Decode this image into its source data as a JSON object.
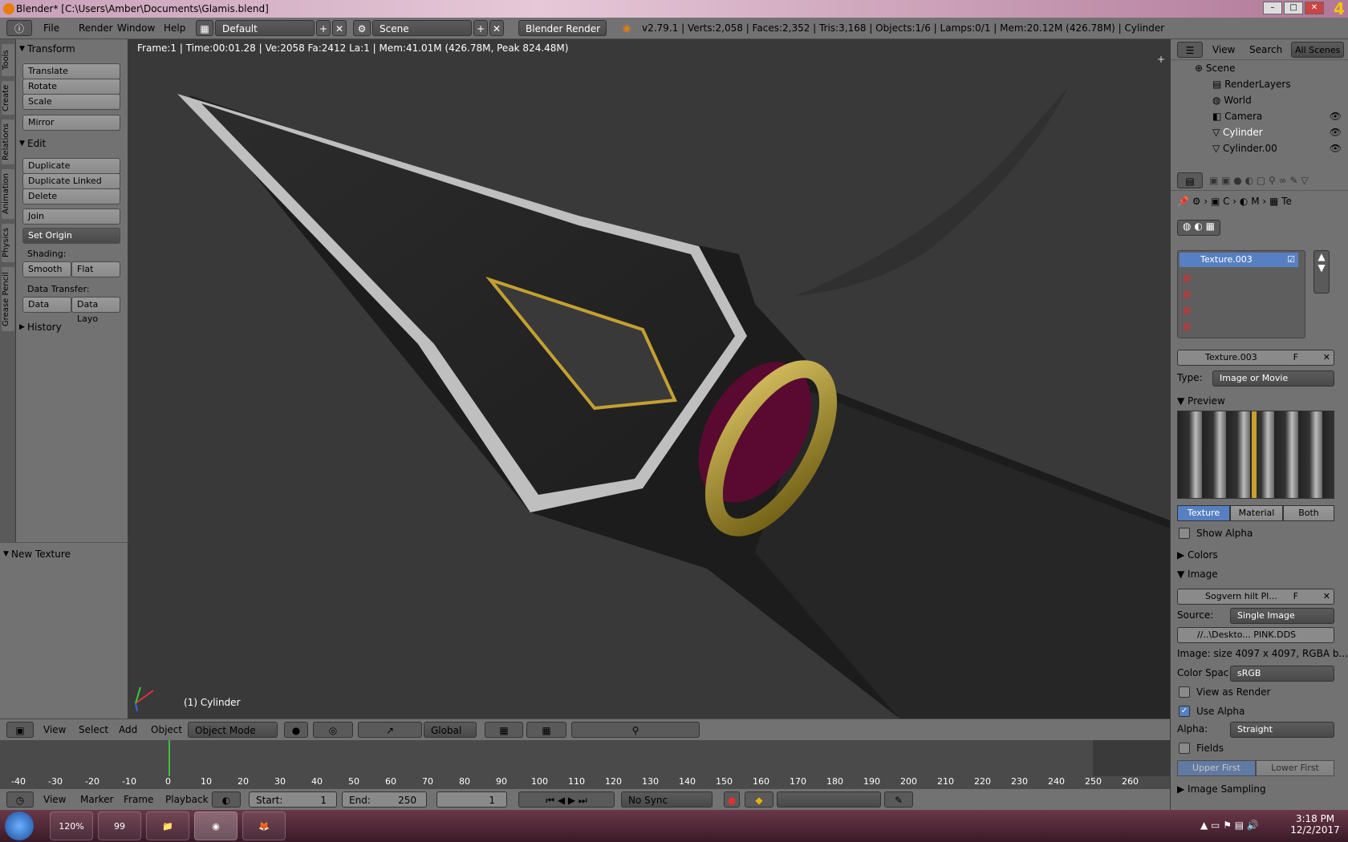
{
  "window": {
    "title": "Blender* [C:\\Users\\Amber\\Documents\\Glamis.blend]",
    "corner_badge": "4"
  },
  "topbar": {
    "menus": [
      "File",
      "Render",
      "Window",
      "Help"
    ],
    "layout": "Default",
    "scene": "Scene",
    "engine": "Blender Render",
    "stats": "v2.79.1 | Verts:2,058 | Faces:2,352 | Tris:3,168 | Objects:1/6 | Lamps:0/1 | Mem:20.12M (426.78M) | Cylinder"
  },
  "left_tabs": [
    "Tools",
    "Create",
    "Relations",
    "Animation",
    "Physics",
    "Grease Pencil"
  ],
  "tools": {
    "transform_title": "Transform",
    "translate": "Translate",
    "rotate": "Rotate",
    "scale": "Scale",
    "mirror": "Mirror",
    "edit_title": "Edit",
    "duplicate": "Duplicate",
    "duplicate_linked": "Duplicate Linked",
    "delete": "Delete",
    "join": "Join",
    "set_origin": "Set Origin",
    "shading_label": "Shading:",
    "smooth": "Smooth",
    "flat": "Flat",
    "data_transfer_label": "Data Transfer:",
    "data": "Data",
    "data_layo": "Data Layo",
    "history_title": "History",
    "new_texture_title": "New Texture"
  },
  "viewport": {
    "info": "Frame:1 | Time:00:01.28 | Ve:2058 Fa:2412 La:1 | Mem:41.01M (426.78M, Peak 824.48M)",
    "object_label": "(1) Cylinder"
  },
  "viewport_header": {
    "view": "View",
    "select": "Select",
    "add": "Add",
    "object": "Object",
    "mode": "Object Mode",
    "orientation": "Global"
  },
  "timeline": {
    "ticks": [
      "-40",
      "-30",
      "-20",
      "-10",
      "0",
      "10",
      "20",
      "30",
      "40",
      "50",
      "60",
      "70",
      "80",
      "90",
      "100",
      "110",
      "120",
      "130",
      "140",
      "150",
      "160",
      "170",
      "180",
      "190",
      "200",
      "210",
      "220",
      "230",
      "240",
      "250",
      "260"
    ],
    "view": "View",
    "marker": "Marker",
    "frame": "Frame",
    "playback": "Playback",
    "start_label": "Start:",
    "start_value": "1",
    "end_label": "End:",
    "end_value": "250",
    "current": "1",
    "sync": "No Sync"
  },
  "outliner": {
    "view": "View",
    "search": "Search",
    "filter": "All Scenes",
    "items": [
      "Scene",
      "RenderLayers",
      "World",
      "Camera",
      "Cylinder",
      "Cylinder.00"
    ]
  },
  "properties": {
    "breadcrumb": [
      "C",
      "M",
      "Te"
    ],
    "texture_slot_name": "Texture.003",
    "texture_name": "Texture.003",
    "fake_user": "F",
    "type_label": "Type:",
    "type_value": "Image or Movie",
    "preview_title": "Preview",
    "preview_tabs": [
      "Texture",
      "Material",
      "Both"
    ],
    "show_alpha": "Show Alpha",
    "colors_title": "Colors",
    "image_title": "Image",
    "image_name": "Sogvern hilt Pl...",
    "source_label": "Source:",
    "source_value": "Single Image",
    "filepath": "//..\\Deskto... PINK.DDS",
    "image_info": "Image: size 4097 x 4097, RGBA b...",
    "color_space_label": "Color Spac",
    "color_space_value": "sRGB",
    "view_as_render": "View as Render",
    "use_alpha": "Use Alpha",
    "alpha_label": "Alpha:",
    "alpha_value": "Straight",
    "fields": "Fields",
    "upper_first": "Upper First",
    "lower_first": "Lower First",
    "image_sampling": "Image Sampling"
  },
  "taskbar": {
    "time": "3:18 PM",
    "date": "12/2/2017",
    "app_badge": "120%",
    "app_badge2": "99"
  }
}
